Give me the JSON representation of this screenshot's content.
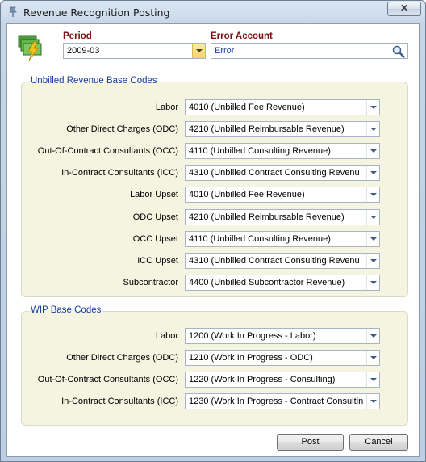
{
  "window": {
    "title": "Revenue Recognition Posting"
  },
  "icons": {
    "app": "pin-icon",
    "header": "money-lightning-icon",
    "close": "close-icon",
    "search": "magnifier-icon"
  },
  "period": {
    "label": "Period",
    "value": "2009-03"
  },
  "error_account": {
    "label": "Error Account",
    "value": "Error"
  },
  "unbilled": {
    "title": "Unbilled Revenue Base Codes",
    "rows": [
      {
        "label": "Labor",
        "value": "4010 (Unbilled Fee Revenue)"
      },
      {
        "label": "Other Direct Charges (ODC)",
        "value": "4210 (Unbilled Reimbursable Revenue)"
      },
      {
        "label": "Out-Of-Contract Consultants (OCC)",
        "value": "4110 (Unbilled Consulting Revenue)"
      },
      {
        "label": "In-Contract Consultants (ICC)",
        "value": "4310 (Unbilled Contract Consulting Revenu"
      },
      {
        "label": "Labor Upset",
        "value": "4010 (Unbilled Fee Revenue)"
      },
      {
        "label": "ODC Upset",
        "value": "4210 (Unbilled Reimbursable Revenue)"
      },
      {
        "label": "OCC Upset",
        "value": "4110 (Unbilled Consulting Revenue)"
      },
      {
        "label": "ICC Upset",
        "value": "4310 (Unbilled Contract Consulting Revenu"
      },
      {
        "label": "Subcontractor",
        "value": "4400 (Unbilled Subcontractor Revenue)"
      }
    ]
  },
  "wip": {
    "title": "WIP Base Codes",
    "rows": [
      {
        "label": "Labor",
        "value": "1200 (Work In Progress - Labor)"
      },
      {
        "label": "Other Direct Charges (ODC)",
        "value": "1210 (Work In Progress - ODC)"
      },
      {
        "label": "Out-Of-Contract Consultants (OCC)",
        "value": "1220 (Work In Progress - Consulting)"
      },
      {
        "label": "In-Contract Consultants (ICC)",
        "value": "1230 (Work In Progress - Contract Consultin"
      }
    ]
  },
  "buttons": {
    "post": "Post",
    "cancel": "Cancel"
  }
}
